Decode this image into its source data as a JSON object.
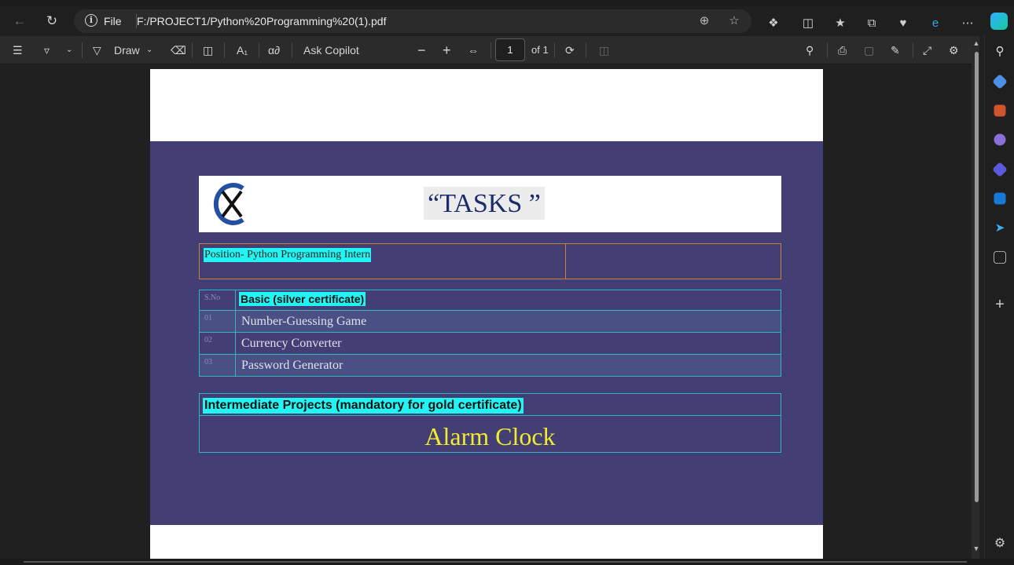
{
  "browser": {
    "address": {
      "scheme_label": "File",
      "url": "F:/PROJECT1/Python%20Programming%20(1).pdf"
    }
  },
  "pdf_toolbar": {
    "draw_label": "Draw",
    "ask_copilot_label": "Ask Copilot",
    "current_page": "1",
    "page_total": "of 1"
  },
  "document": {
    "title": "“TASKS ”",
    "position_label": "Position- Python Programming Intern",
    "basic": {
      "no_header": "S.No",
      "title": "Basic (silver certificate)",
      "items": [
        {
          "no": "01",
          "task": "Number-Guessing Game"
        },
        {
          "no": "02",
          "task": "Currency Converter"
        },
        {
          "no": "03",
          "task": "Password Generator"
        }
      ]
    },
    "intermediate": {
      "title": "Intermediate Projects (mandatory for gold certificate)",
      "project": "Alarm Clock"
    }
  },
  "colors": {
    "band": "#433f74",
    "highlight": "#22f4f4",
    "title_text": "#1c2c6c",
    "alarm_text": "#f2ec2e"
  }
}
